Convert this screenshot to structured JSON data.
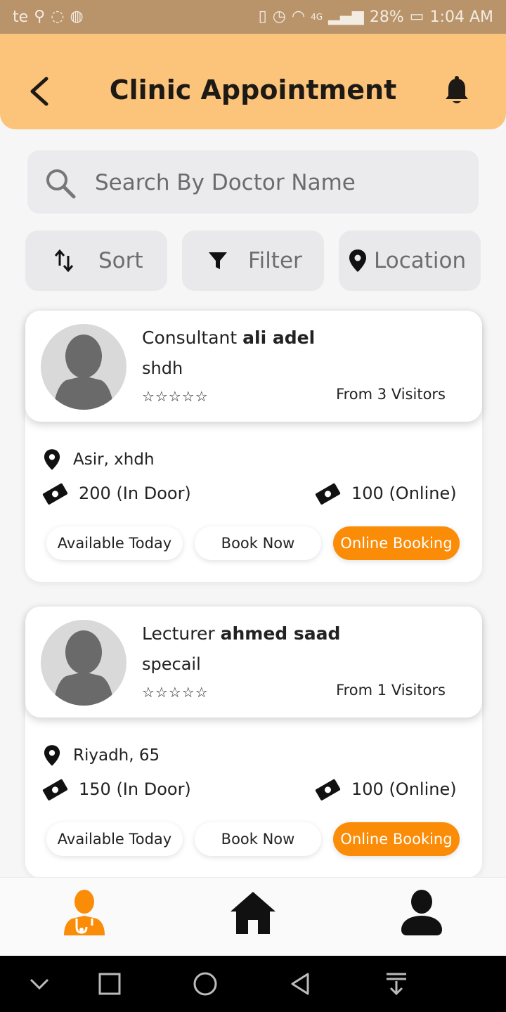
{
  "status_bar": {
    "left_text": "te",
    "battery": "28%",
    "time": "1:04 AM",
    "network": "4G"
  },
  "header": {
    "title": "Clinic Appointment"
  },
  "search": {
    "placeholder": "Search By Doctor Name"
  },
  "toolbar": {
    "sort_label": "Sort",
    "filter_label": "Filter",
    "location_label": "Location"
  },
  "doctors": [
    {
      "title": "Consultant",
      "name": "ali adel",
      "specialty": "shdh",
      "rating_stars": "☆☆☆☆☆",
      "visitors": "From 3 Visitors",
      "location": "Asir, xhdh",
      "indoor_fee": "200 (In Door)",
      "online_fee": "100 (Online)",
      "available_label": "Available Today",
      "book_label": "Book Now",
      "online_label": "Online Booking"
    },
    {
      "title": "Lecturer",
      "name": "ahmed saad",
      "specialty": "specail",
      "rating_stars": "☆☆☆☆☆",
      "visitors": "From 1 Visitors",
      "location": "Riyadh, 65",
      "indoor_fee": "150 (In Door)",
      "online_fee": "100 (Online)",
      "available_label": "Available Today",
      "book_label": "Book Now",
      "online_label": "Online Booking"
    }
  ],
  "colors": {
    "header_bg": "#fcc37a",
    "status_bg": "#b9936a",
    "accent": "#fb8c07"
  },
  "icons": {
    "nav": [
      "doctor-icon",
      "home-icon",
      "profile-icon"
    ],
    "system_nav": [
      "chevron-down-icon",
      "recents-icon",
      "home-circle-icon",
      "back-triangle-icon",
      "notification-pull-icon"
    ]
  }
}
